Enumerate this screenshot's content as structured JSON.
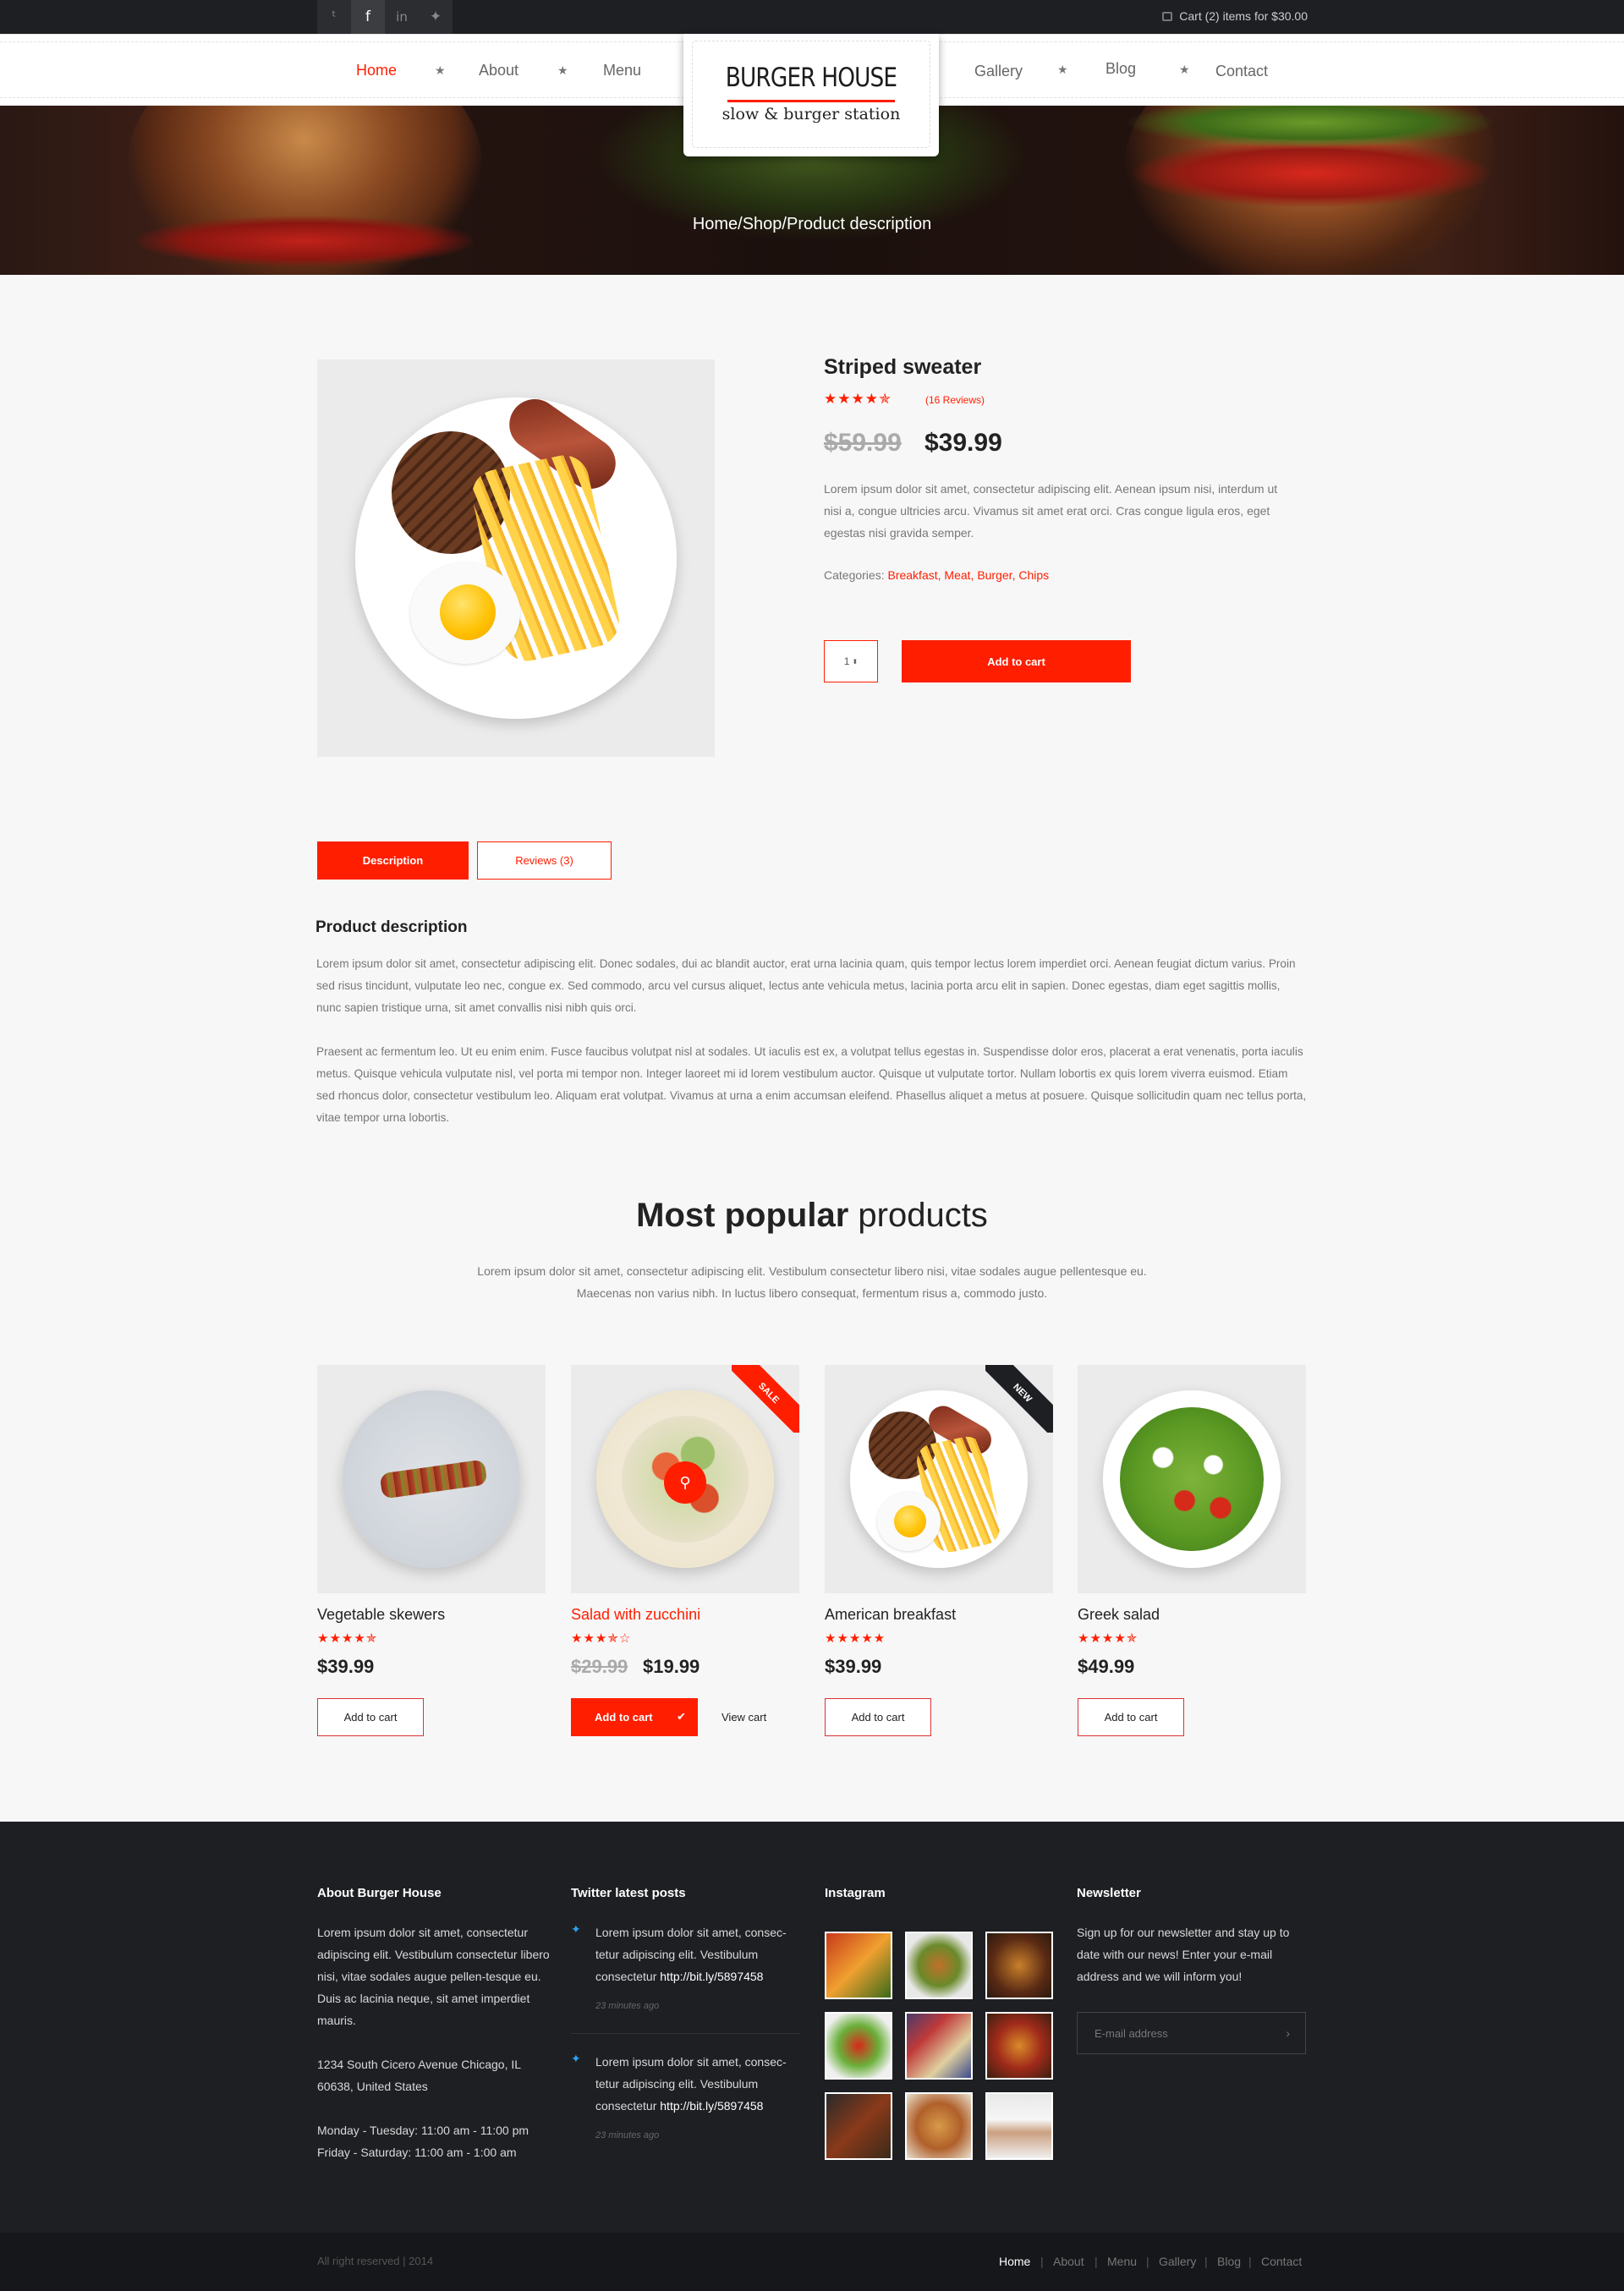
{
  "topbar": {
    "cart_text": "Cart (2) items for $30.00",
    "social_icons": [
      "twitter-icon",
      "facebook-icon",
      "linkedin-icon",
      "evernote-icon"
    ],
    "social_glyphs": [
      "ᵗ",
      "f",
      "in",
      "✦"
    ]
  },
  "nav": {
    "items": [
      "Home",
      "About",
      "Menu",
      "Gallery",
      "Blog",
      "Contact"
    ],
    "active": "Home"
  },
  "logo": {
    "title": "BURGER HOUSE",
    "subtitle": "slow & burger station"
  },
  "breadcrumb": "Home/Shop/Product description",
  "product": {
    "name": "Striped sweater",
    "rating_stars": "★★★★✯",
    "reviews": "(16 Reviews)",
    "old_price": "$59.99",
    "price": "$39.99",
    "description": "Lorem ipsum dolor sit amet, consectetur adipiscing elit. Aenean ipsum nisi, interdum ut nisi a, congue ultricies arcu. Vivamus sit amet erat orci. Cras congue ligula eros, eget egestas nisi gravida semper.",
    "categories_label": "Categories:",
    "categories": [
      "Breakfast",
      "Meat",
      "Burger",
      "Chips"
    ],
    "quantity": "1",
    "add_to_cart": "Add to cart"
  },
  "tabs": {
    "description": "Description",
    "reviews": "Reviews (3)"
  },
  "desc": {
    "title": "Product description",
    "p1": "Lorem ipsum dolor sit amet, consectetur adipiscing elit. Donec sodales, dui ac blandit auctor, erat urna lacinia quam, quis tempor lectus lorem imperdiet orci. Aenean feugiat dictum varius. Proin sed risus tincidunt, vulputate leo nec, congue ex. Sed commodo, arcu vel cursus aliquet, lectus ante vehicula metus, lacinia porta arcu elit in sapien. Donec egestas, diam eget sagittis mollis, nunc sapien tristique urna, sit amet convallis nisi nibh quis orci.",
    "p2": "Praesent ac fermentum leo. Ut eu enim enim. Fusce faucibus volutpat nisl at sodales. Ut iaculis est ex, a volutpat tellus egestas in. Suspendisse dolor eros, placerat a erat venenatis, porta iaculis metus. Quisque vehicula vulputate nisl, vel porta mi tempor non. Integer laoreet mi id lorem vestibulum auctor. Quisque ut vulputate tortor. Nullam lobortis ex quis lorem viverra euismod. Etiam sed rhoncus dolor, consectetur vestibulum leo. Aliquam erat volutpat. Vivamus at urna a enim accumsan eleifend. Phasellus aliquet a metus at posuere. Quisque sollicitudin quam nec tellus porta, vitae tempor urna lobortis."
  },
  "popular": {
    "title_bold": "Most popular",
    "title_light": "products",
    "subtitle1": "Lorem ipsum dolor sit amet, consectetur adipiscing elit. Vestibulum consectetur libero nisi, vitae sodales augue pellentesque eu.",
    "subtitle2": "Maecenas non varius nibh. In luctus libero consequat, fermentum risus a, commodo justo.",
    "items": [
      {
        "name": "Vegetable skewers",
        "stars": "★★★★✯",
        "price": "$39.99",
        "button": "Add to cart"
      },
      {
        "name": "Salad with zucchini",
        "stars": "★★★✯☆",
        "old_price": "$29.99",
        "price": "$19.99",
        "button": "Add to cart",
        "view": "View cart",
        "badge": "SALE"
      },
      {
        "name": "American breakfast",
        "stars": "★★★★★",
        "price": "$39.99",
        "button": "Add to cart",
        "badge": "NEW"
      },
      {
        "name": "Greek salad",
        "stars": "★★★★✯",
        "price": "$49.99",
        "button": "Add to cart"
      }
    ]
  },
  "footer": {
    "about": {
      "title": "About Burger House",
      "text": "Lorem ipsum dolor sit amet, consectetur adipiscing elit. Vestibulum consectetur libero nisi, vitae sodales augue pellen-tesque eu. Duis ac lacinia neque, sit amet imperdiet mauris.",
      "address1": "1234 South Cicero Avenue Chicago, IL",
      "address2": "60638, United States",
      "hours1": "Monday - Tuesday: 11:00 am - 11:00 pm",
      "hours2": "Friday - Saturday: 11:00 am - 1:00 am"
    },
    "twitter": {
      "title": "Twitter latest posts",
      "posts": [
        {
          "l1": "Lorem ipsum dolor sit amet, consec-",
          "l2": "tetur adipiscing elit. Vestibulum",
          "l3": "consectetur",
          "link": "http://bit.ly/5897458",
          "time": "23 minutes ago"
        },
        {
          "l1": "Lorem ipsum dolor sit amet, consec-",
          "l2": "tetur adipiscing elit. Vestibulum",
          "l3": "consectetur",
          "link": "http://bit.ly/5897458",
          "time": "23 minutes ago"
        }
      ]
    },
    "instagram": {
      "title": "Instagram"
    },
    "newsletter": {
      "title": "Newsletter",
      "text": "Sign up for our newsletter and stay up to date with our news! Enter your e-mail address and we will inform you!",
      "placeholder": "E-mail address"
    }
  },
  "bottom": {
    "copyright": "All right reserved | 2014",
    "links": [
      "Home",
      "About",
      "Menu",
      "Gallery",
      "Blog",
      "Contact"
    ]
  }
}
